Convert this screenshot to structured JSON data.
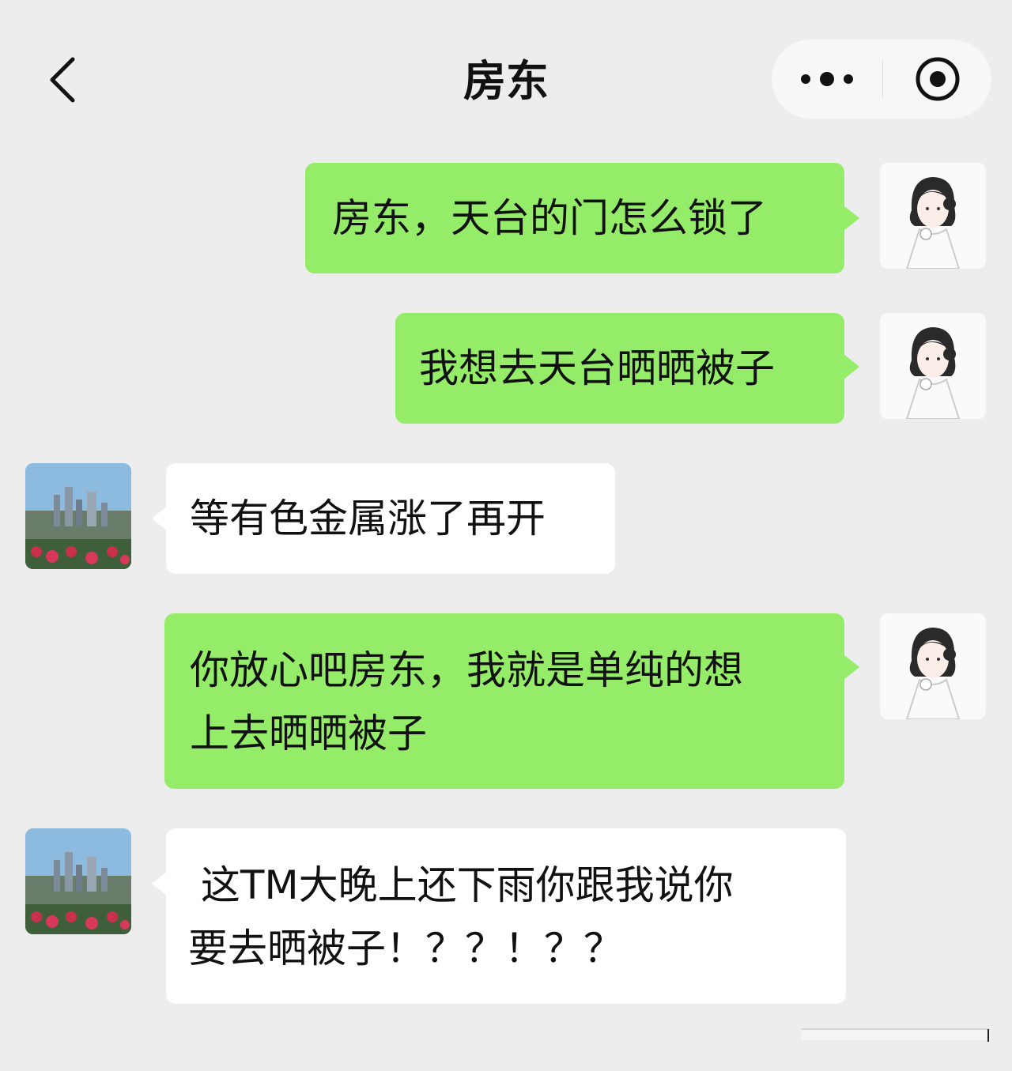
{
  "header": {
    "title": "房东",
    "back_icon": "chevron-left-icon",
    "more_icon": "more-dots-icon",
    "close_icon": "target-close-icon"
  },
  "colors": {
    "background": "#ededed",
    "my_bubble": "#95ec69",
    "their_bubble": "#ffffff"
  },
  "messages": [
    {
      "from": "me",
      "text": "房东，天台的门怎么锁了"
    },
    {
      "from": "me",
      "text": "我想去天台晒晒被子"
    },
    {
      "from": "landlord",
      "text": "等有色金属涨了再开"
    },
    {
      "from": "me",
      "text": "你放心吧房东，我就是单纯的想\n上去晒晒被子"
    },
    {
      "from": "landlord",
      "text": " 这TM大晚上还下雨你跟我说你\n要去晒被子！？？！？？"
    }
  ]
}
